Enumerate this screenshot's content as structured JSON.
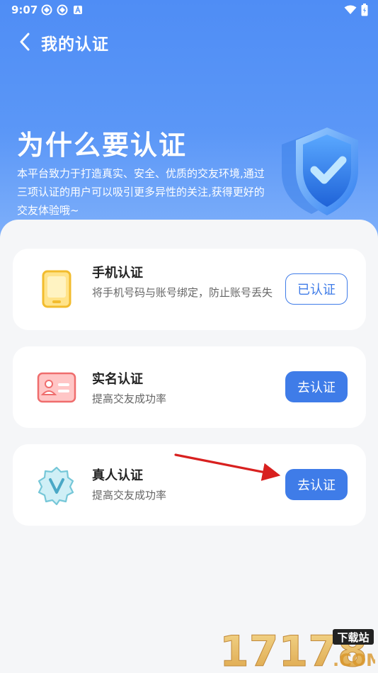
{
  "status": {
    "time": "9:07"
  },
  "nav": {
    "title": "我的认证"
  },
  "hero": {
    "title": "为什么要认证",
    "description": "本平台致力于打造真实、安全、优质的交友环境,通过三项认证的用户可以吸引更多异性的关注,获得更好的交友体验哦~"
  },
  "cards": [
    {
      "title": "手机认证",
      "desc": "将手机号码与账号绑定，防止账号丢失",
      "button": "已认证",
      "status": "verified",
      "icon": "phone-icon"
    },
    {
      "title": "实名认证",
      "desc": "提高交友成功率",
      "button": "去认证",
      "status": "pending",
      "icon": "id-card-icon"
    },
    {
      "title": "真人认证",
      "desc": "提高交友成功率",
      "button": "去认证",
      "status": "pending",
      "icon": "verified-badge-icon"
    }
  ],
  "watermark": {
    "text": "17178",
    "badge": "下载站",
    "suffix": ".COM"
  },
  "colors": {
    "accent": "#3f7ce8",
    "hero_top": "#4f8df5",
    "annotation_arrow": "#d8201f"
  }
}
